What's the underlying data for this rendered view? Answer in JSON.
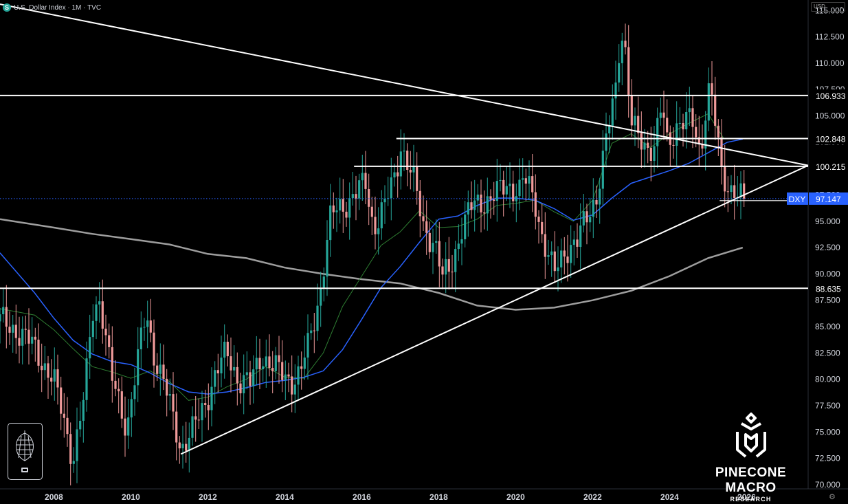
{
  "header": {
    "symbol_icon": "S",
    "title": "U.S. Dollar Index · 1M · TVC"
  },
  "currency_selector": {
    "label": "USD",
    "icon": "chevron-down-icon"
  },
  "brand": {
    "name": "PINECONE MACRO",
    "subtitle": "RESEARCH",
    "logo_icon": "pinecone-mark-icon"
  },
  "left_logo": {
    "icon": "pinecone-icon",
    "badge_icon": "flag-icon"
  },
  "settings_icon": "gear-icon",
  "colors": {
    "background": "#000000",
    "up": "#26a69a",
    "down": "#ef9a9a",
    "ma_short": "#2e7d32",
    "ma_mid": "#2962ff",
    "ma_long": "#9e9e9e",
    "line": "#ffffff",
    "price_label": "#2962ff"
  },
  "chart_data": {
    "type": "candlestick",
    "symbol": "DXY",
    "timeframe": "1M",
    "x_range": [
      2006.6,
      2027.6
    ],
    "ylim": [
      69.6,
      116.0
    ],
    "x_ticks": [
      2008,
      2010,
      2012,
      2014,
      2016,
      2018,
      2020,
      2022,
      2024,
      2026
    ],
    "y_ticks": [
      "70.000",
      "72.500",
      "75.000",
      "77.500",
      "80.000",
      "82.500",
      "85.000",
      "87.500",
      "90.000",
      "92.500",
      "95.000",
      "97.500",
      "100.000",
      "102.500",
      "105.000",
      "107.500",
      "110.000",
      "112.500",
      "115.000"
    ],
    "horizontal_levels": [
      {
        "label": "106.933",
        "value": 106.933,
        "x_start": 2006.6
      },
      {
        "label": "102.848",
        "value": 102.848,
        "x_start": 2016.9
      },
      {
        "label": "100.215",
        "value": 100.215,
        "x_start": 2015.8
      },
      {
        "label": "88.635",
        "value": 88.635,
        "x_start": 2006.6
      },
      {
        "label": "96.960",
        "value": 96.96,
        "x_start": 2025.3
      }
    ],
    "trendlines": [
      {
        "points": [
          [
            2006.6,
            115.6
          ],
          [
            2027.6,
            100.3
          ]
        ]
      },
      {
        "points": [
          [
            2011.3,
            72.9
          ],
          [
            2027.6,
            100.3
          ]
        ]
      }
    ],
    "current_price": {
      "label": "DXY",
      "value": "97.147",
      "y": 97.147
    },
    "moving_averages": {
      "short": [
        [
          2006.6,
          86.7
        ],
        [
          2007.5,
          86.1
        ],
        [
          2008.0,
          84.7
        ],
        [
          2008.5,
          82.9
        ],
        [
          2009.0,
          81.2
        ],
        [
          2009.5,
          80.7
        ],
        [
          2010.0,
          80.1
        ],
        [
          2010.5,
          80.8
        ],
        [
          2011.0,
          79.8
        ],
        [
          2011.5,
          78.0
        ],
        [
          2012.0,
          78.3
        ],
        [
          2012.5,
          79.3
        ],
        [
          2013.0,
          80.0
        ],
        [
          2013.5,
          81.2
        ],
        [
          2014.0,
          80.2
        ],
        [
          2014.5,
          80.1
        ],
        [
          2015.0,
          82.5
        ],
        [
          2015.5,
          86.9
        ],
        [
          2016.0,
          89.8
        ],
        [
          2016.5,
          92.7
        ],
        [
          2017.0,
          94.0
        ],
        [
          2017.5,
          96.0
        ],
        [
          2018.0,
          94.4
        ],
        [
          2018.5,
          94.5
        ],
        [
          2019.0,
          95.2
        ],
        [
          2019.5,
          96.5
        ],
        [
          2020.0,
          96.7
        ],
        [
          2020.5,
          97.0
        ],
        [
          2021.0,
          95.9
        ],
        [
          2021.5,
          95.0
        ],
        [
          2022.0,
          97.0
        ],
        [
          2022.5,
          102.4
        ],
        [
          2023.0,
          103.3
        ],
        [
          2023.5,
          102.0
        ],
        [
          2024.0,
          103.3
        ],
        [
          2024.5,
          104.3
        ],
        [
          2025.0,
          105.2
        ],
        [
          2025.4,
          102.9
        ]
      ],
      "mid": [
        [
          2006.6,
          92.0
        ],
        [
          2007.5,
          88.2
        ],
        [
          2008.0,
          85.8
        ],
        [
          2008.5,
          83.7
        ],
        [
          2009.0,
          82.4
        ],
        [
          2009.5,
          81.7
        ],
        [
          2010.0,
          81.4
        ],
        [
          2010.5,
          80.6
        ],
        [
          2011.0,
          79.6
        ],
        [
          2011.5,
          78.8
        ],
        [
          2012.0,
          78.6
        ],
        [
          2012.5,
          78.8
        ],
        [
          2013.0,
          79.2
        ],
        [
          2013.5,
          79.7
        ],
        [
          2014.0,
          79.9
        ],
        [
          2014.5,
          80.2
        ],
        [
          2015.0,
          80.8
        ],
        [
          2015.5,
          82.8
        ],
        [
          2016.0,
          85.7
        ],
        [
          2016.5,
          88.7
        ],
        [
          2017.0,
          90.7
        ],
        [
          2017.5,
          93.0
        ],
        [
          2018.0,
          95.2
        ],
        [
          2018.5,
          95.5
        ],
        [
          2019.0,
          96.5
        ],
        [
          2019.5,
          97.2
        ],
        [
          2020.0,
          97.2
        ],
        [
          2020.5,
          97.0
        ],
        [
          2021.0,
          96.2
        ],
        [
          2021.5,
          95.1
        ],
        [
          2022.0,
          95.6
        ],
        [
          2022.5,
          97.2
        ],
        [
          2023.0,
          98.6
        ],
        [
          2023.5,
          99.2
        ],
        [
          2024.0,
          99.8
        ],
        [
          2024.5,
          100.5
        ],
        [
          2025.0,
          101.5
        ],
        [
          2025.5,
          102.5
        ],
        [
          2025.9,
          102.8
        ]
      ],
      "long": [
        [
          2006.6,
          95.2
        ],
        [
          2008.0,
          94.4
        ],
        [
          2009.0,
          93.8
        ],
        [
          2010.0,
          93.3
        ],
        [
          2011.0,
          92.8
        ],
        [
          2012.0,
          91.9
        ],
        [
          2013.0,
          91.5
        ],
        [
          2014.0,
          90.6
        ],
        [
          2015.0,
          90.0
        ],
        [
          2016.0,
          89.5
        ],
        [
          2017.0,
          89.1
        ],
        [
          2018.0,
          88.2
        ],
        [
          2019.0,
          87.0
        ],
        [
          2020.0,
          86.6
        ],
        [
          2021.0,
          86.8
        ],
        [
          2022.0,
          87.5
        ],
        [
          2023.0,
          88.4
        ],
        [
          2024.0,
          89.8
        ],
        [
          2025.0,
          91.5
        ],
        [
          2025.9,
          92.5
        ]
      ]
    },
    "candle_anchors": [
      [
        2006.6,
        85.5
      ],
      [
        2007.0,
        84.8
      ],
      [
        2007.5,
        83.0
      ],
      [
        2008.0,
        79.8
      ],
      [
        2008.3,
        75.5
      ],
      [
        2008.5,
        72.5
      ],
      [
        2008.8,
        78.5
      ],
      [
        2009.0,
        86.5
      ],
      [
        2009.2,
        87.8
      ],
      [
        2009.5,
        80.0
      ],
      [
        2009.9,
        75.5
      ],
      [
        2010.1,
        80.0
      ],
      [
        2010.4,
        86.5
      ],
      [
        2010.6,
        82.5
      ],
      [
        2010.9,
        79.0
      ],
      [
        2011.2,
        75.0
      ],
      [
        2011.3,
        73.5
      ],
      [
        2011.6,
        75.0
      ],
      [
        2011.9,
        77.5
      ],
      [
        2012.2,
        80.5
      ],
      [
        2012.5,
        82.5
      ],
      [
        2012.8,
        80.0
      ],
      [
        2013.1,
        79.5
      ],
      [
        2013.4,
        82.5
      ],
      [
        2013.6,
        81.5
      ],
      [
        2013.9,
        80.5
      ],
      [
        2014.2,
        80.0
      ],
      [
        2014.4,
        80.5
      ],
      [
        2014.6,
        83.0
      ],
      [
        2014.9,
        88.0
      ],
      [
        2015.2,
        95.5
      ],
      [
        2015.5,
        96.5
      ],
      [
        2015.8,
        97.5
      ],
      [
        2016.1,
        98.5
      ],
      [
        2016.3,
        94.5
      ],
      [
        2016.6,
        96.5
      ],
      [
        2016.9,
        99.5
      ],
      [
        2017.0,
        102.5
      ],
      [
        2017.3,
        99.5
      ],
      [
        2017.6,
        94.5
      ],
      [
        2017.9,
        93.0
      ],
      [
        2018.1,
        89.5
      ],
      [
        2018.3,
        90.5
      ],
      [
        2018.6,
        94.5
      ],
      [
        2018.9,
        96.5
      ],
      [
        2019.2,
        97.0
      ],
      [
        2019.5,
        97.5
      ],
      [
        2019.8,
        98.5
      ],
      [
        2020.1,
        98.0
      ],
      [
        2020.2,
        99.0
      ],
      [
        2020.5,
        97.0
      ],
      [
        2020.7,
        93.5
      ],
      [
        2020.9,
        91.0
      ],
      [
        2021.0,
        89.9
      ],
      [
        2021.3,
        92.5
      ],
      [
        2021.6,
        93.0
      ],
      [
        2021.9,
        95.8
      ],
      [
        2022.1,
        97.5
      ],
      [
        2022.3,
        101.5
      ],
      [
        2022.6,
        107.5
      ],
      [
        2022.7,
        112.0
      ],
      [
        2022.8,
        113.5
      ],
      [
        2023.0,
        104.5
      ],
      [
        2023.2,
        102.5
      ],
      [
        2023.4,
        102.0
      ],
      [
        2023.6,
        102.5
      ],
      [
        2023.8,
        106.0
      ],
      [
        2023.95,
        101.5
      ],
      [
        2024.2,
        104.5
      ],
      [
        2024.4,
        105.0
      ],
      [
        2024.6,
        104.0
      ],
      [
        2024.8,
        101.0
      ],
      [
        2024.95,
        106.5
      ],
      [
        2025.05,
        108.5
      ],
      [
        2025.2,
        104.0
      ],
      [
        2025.35,
        99.0
      ],
      [
        2025.5,
        98.0
      ],
      [
        2025.7,
        98.5
      ],
      [
        2025.85,
        97.6
      ],
      [
        2025.95,
        97.15
      ]
    ]
  }
}
